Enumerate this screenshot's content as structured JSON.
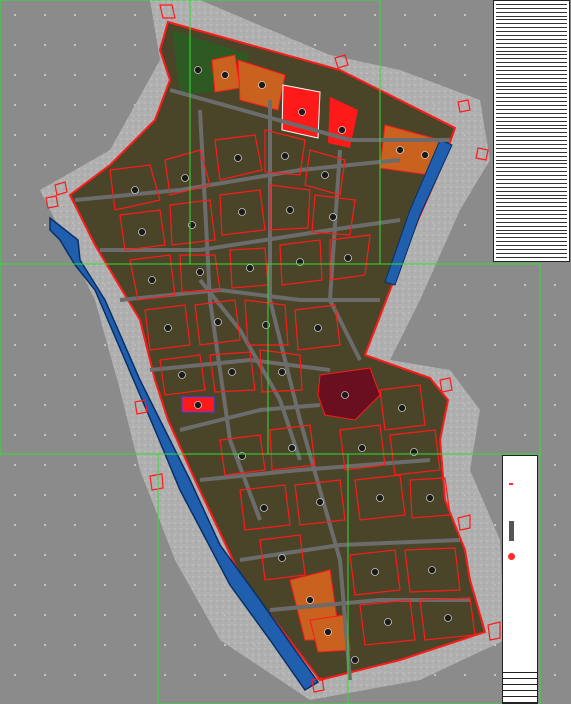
{
  "map": {
    "type": "cad-urban-master-plan",
    "colors": {
      "background": "#8b8b8b",
      "block_fill": "#4a4528",
      "block_outline": "#ff1a1a",
      "road": "#6c6c6c",
      "river": "#1f5fae",
      "river_outline": "#0a2f66",
      "green_space": "#2d5a22",
      "public_facility": "#ff1a1a",
      "commercial": "#c8621e",
      "civic": "#6a0f1f",
      "boundary": "#ff0000",
      "sheet_frame": "#33dd33"
    },
    "features": [
      "residential-blocks",
      "road-network",
      "river-channel",
      "green-belt",
      "public-facility-plots",
      "commercial-plots",
      "civic-center"
    ]
  },
  "legend_table": {
    "row_count": 85
  },
  "title_block": {}
}
